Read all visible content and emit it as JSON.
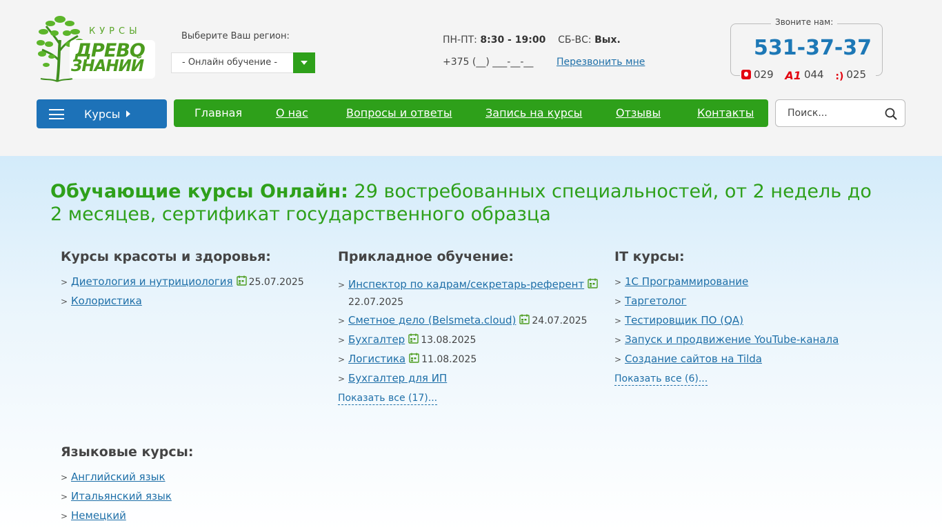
{
  "logo": {
    "kursy": "КУРСЫ",
    "line1": "ДРЕВО",
    "line2": "ЗНАНИЙ"
  },
  "region": {
    "label": "Выберите Ваш регион:",
    "value": "- Онлайн обучение -"
  },
  "schedule": {
    "weekdays_label": "ПН-ПТ:",
    "weekdays_time": "8:30 - 19:00",
    "weekend_label": "СБ-ВС:",
    "weekend_time": "Вых."
  },
  "phone_mask": "+375 (__) ___-__-__",
  "callback": "Перезвонить мне",
  "callbox": {
    "label": "Звоните нам:",
    "number": "531-37-37",
    "operators": [
      {
        "icon": "mts-icon",
        "code": "029"
      },
      {
        "icon": "a1-icon",
        "code": "044"
      },
      {
        "icon": "life-icon",
        "code": "025"
      }
    ]
  },
  "menu": {
    "courses_label": "Курсы",
    "items": [
      "Главная",
      "О нас",
      "Вопросы и ответы",
      "Запись на курсы",
      "Отзывы",
      "Контакты"
    ]
  },
  "search": {
    "placeholder": "Поиск..."
  },
  "headline": {
    "bold": "Обучающие курсы Онлайн:",
    "rest": " 29 востребованных специальностей, от 2 недель до 2 месяцев, сертификат государственного образца"
  },
  "columns": [
    {
      "title": "Курсы красоты и здоровья:",
      "items": [
        {
          "label": "Диетология и нутрициология",
          "date": "25.07.2025"
        },
        {
          "label": "Колористика",
          "date": ""
        }
      ],
      "more": ""
    },
    {
      "title": "Прикладное обучение:",
      "items": [
        {
          "label": "Инспектор по кадрам/секретарь-референт",
          "date": "22.07.2025"
        },
        {
          "label": "Сметное дело (Belsmeta.cloud)",
          "date": "24.07.2025"
        },
        {
          "label": "Бухгалтер",
          "date": "13.08.2025"
        },
        {
          "label": "Логистика",
          "date": "11.08.2025"
        },
        {
          "label": "Бухгалтер для ИП",
          "date": ""
        }
      ],
      "more": "Показать все (17)..."
    },
    {
      "title": "IT курсы:",
      "items": [
        {
          "label": "1С Программирование",
          "date": ""
        },
        {
          "label": "Таргетолог",
          "date": ""
        },
        {
          "label": "Тестировщик ПО (QA)",
          "date": ""
        },
        {
          "label": "Запуск и продвижение YouTube-канала",
          "date": ""
        },
        {
          "label": "Создание сайтов на Tilda",
          "date": ""
        }
      ],
      "more": "Показать все (6)..."
    },
    {
      "title": "Языковые курсы:",
      "items": [
        {
          "label": "Английский язык",
          "date": ""
        },
        {
          "label": "Итальянский язык",
          "date": ""
        },
        {
          "label": "Немецкий",
          "date": ""
        }
      ],
      "more": ""
    }
  ],
  "colors": {
    "green": "#2ea01a",
    "blue": "#1d72b8",
    "link": "#1e6fa8",
    "phone": "#1d78b6"
  }
}
